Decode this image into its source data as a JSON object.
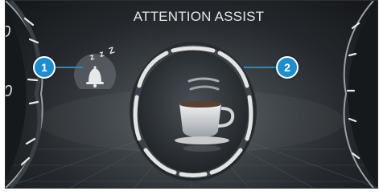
{
  "screen": {
    "title": "ATTENTION ASSIST"
  },
  "left_gauge": {
    "partial_numerals": [
      "0",
      "0"
    ]
  },
  "icons": {
    "tiredness": "tired-bell-zzz-icon",
    "tiredness_zzz": "z z Z",
    "coffee": "coffee-cup-icon"
  },
  "callouts": [
    {
      "number": "1"
    },
    {
      "number": "2"
    }
  ],
  "colors": {
    "callout": "#1c8ed0",
    "display_bg": "#2e3338",
    "ring": "#d8dadc"
  }
}
